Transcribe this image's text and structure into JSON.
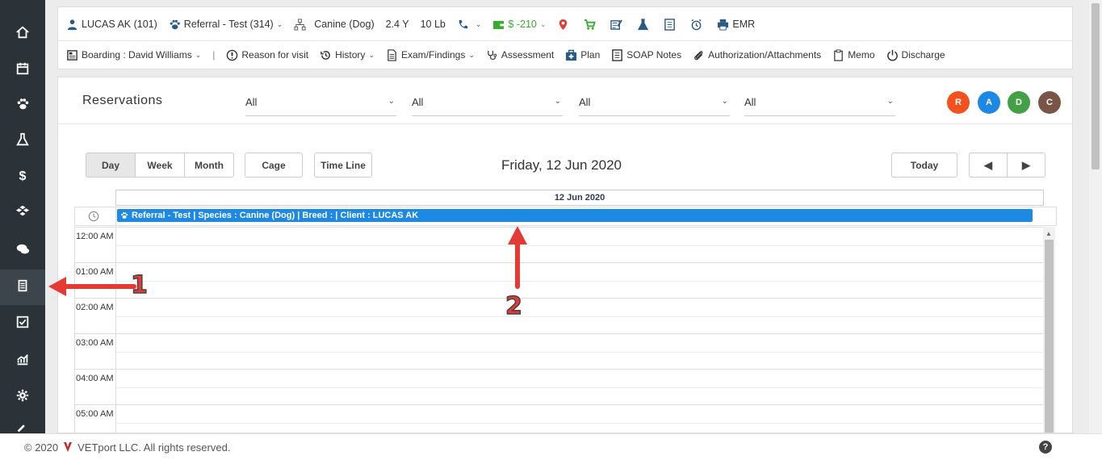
{
  "sidebar": {
    "items": [
      {
        "name": "home-icon"
      },
      {
        "name": "calendar-icon"
      },
      {
        "name": "paw-icon"
      },
      {
        "name": "flask-icon"
      },
      {
        "name": "dollar-icon"
      },
      {
        "name": "boxes-icon"
      },
      {
        "name": "chat-icon"
      },
      {
        "name": "boarding-icon",
        "active": true
      },
      {
        "name": "checklist-icon"
      },
      {
        "name": "chart-icon"
      },
      {
        "name": "gear-icon"
      },
      {
        "name": "wrench-icon"
      }
    ]
  },
  "patient_bar": {
    "client": "LUCAS AK (101)",
    "patient": "Referral - Test (314)",
    "species": "Canine (Dog)",
    "age": "2.4 Y",
    "weight": "10 Lb",
    "balance": "$ -210",
    "emr": "EMR"
  },
  "nav_bar": {
    "boarding": "Boarding : David Williams",
    "separator": "|",
    "reason": "Reason for visit",
    "history": "History",
    "exam": "Exam/Findings",
    "assessment": "Assessment",
    "plan": "Plan",
    "soap": "SOAP Notes",
    "authorization": "Authorization/Attachments",
    "memo": "Memo",
    "discharge": "Discharge"
  },
  "reservations": {
    "title": "Reservations",
    "filters": [
      "All",
      "All",
      "All",
      "All"
    ],
    "badges": [
      {
        "letter": "R",
        "color": "#f4511e"
      },
      {
        "letter": "A",
        "color": "#1e88e5"
      },
      {
        "letter": "D",
        "color": "#43a047"
      },
      {
        "letter": "C",
        "color": "#795548"
      }
    ]
  },
  "toolbar": {
    "day": "Day",
    "week": "Week",
    "month": "Month",
    "cage": "Cage",
    "timeline": "Time Line",
    "date_title": "Friday, 12 Jun 2020",
    "today": "Today",
    "prev": "◀",
    "next": "▶"
  },
  "calendar": {
    "column_date": "12 Jun 2020",
    "event": "Referral - Test | Species : Canine (Dog) | Breed : | Client : LUCAS AK",
    "hours": [
      "12:00 AM",
      "01:00 AM",
      "02:00 AM",
      "03:00 AM",
      "04:00 AM",
      "05:00 AM"
    ]
  },
  "annotations": {
    "one": "1",
    "two": "2",
    "color": "#e53935"
  },
  "footer": {
    "copyright": "© 2020",
    "company": "VETport LLC. All rights reserved.",
    "help": "?"
  }
}
